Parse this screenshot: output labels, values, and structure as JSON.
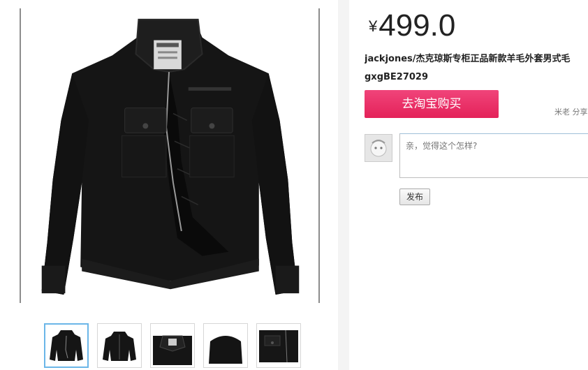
{
  "product": {
    "currency": "¥",
    "price": "499.0",
    "title_line1": "jackjones/杰克琼斯专柜正品新款羊毛外套男式毛",
    "title_line2": "gxgBE27029"
  },
  "buy_button": {
    "label": "去淘宝购买"
  },
  "share": {
    "label": "米老 分享"
  },
  "comment": {
    "placeholder": "亲，觉得这个怎样?"
  },
  "post_button": {
    "label": "发布"
  },
  "thumbnails": [
    {
      "icon": "jacket-front-thumbnail"
    },
    {
      "icon": "jacket-front-thumbnail"
    },
    {
      "icon": "jacket-collar-detail-thumbnail"
    },
    {
      "icon": "jacket-back-thumbnail"
    },
    {
      "icon": "jacket-pocket-detail-thumbnail"
    }
  ],
  "colors": {
    "buy_button": "#ee2a64",
    "thumb_active_border": "#6bb6e8",
    "jacket": "#141414"
  }
}
